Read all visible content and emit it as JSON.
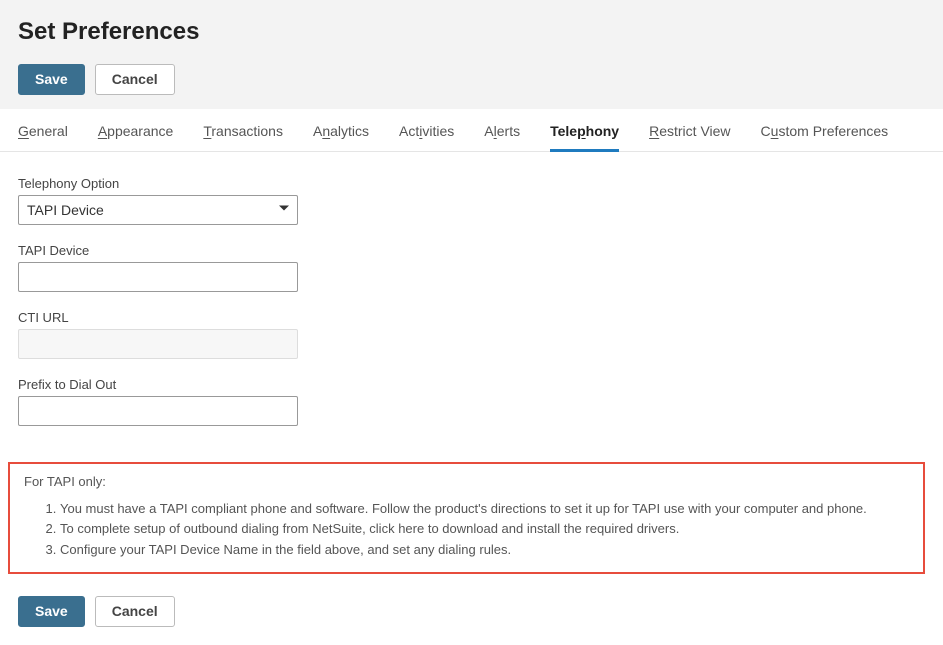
{
  "page": {
    "title": "Set Preferences"
  },
  "buttons": {
    "save": "Save",
    "cancel": "Cancel"
  },
  "tabs": [
    {
      "pre": "",
      "u": "G",
      "post": "eneral",
      "active": false
    },
    {
      "pre": "",
      "u": "A",
      "post": "ppearance",
      "active": false
    },
    {
      "pre": "",
      "u": "T",
      "post": "ransactions",
      "active": false
    },
    {
      "pre": "A",
      "u": "n",
      "post": "alytics",
      "active": false
    },
    {
      "pre": "Act",
      "u": "i",
      "post": "vities",
      "active": false
    },
    {
      "pre": "A",
      "u": "l",
      "post": "erts",
      "active": false
    },
    {
      "pre": "Tele",
      "u": "p",
      "post": "hony",
      "active": true
    },
    {
      "pre": "",
      "u": "R",
      "post": "estrict View",
      "active": false
    },
    {
      "pre": "C",
      "u": "u",
      "post": "stom Preferences",
      "active": false
    }
  ],
  "form": {
    "telephony_option": {
      "label": "Telephony Option",
      "value": "TAPI Device"
    },
    "tapi_device": {
      "label": "TAPI Device",
      "value": ""
    },
    "cti_url": {
      "label": "CTI URL",
      "value": ""
    },
    "prefix": {
      "label": "Prefix to Dial Out",
      "value": ""
    }
  },
  "info": {
    "heading": "For TAPI only:",
    "items": [
      {
        "pre": "You must have a TAPI compliant phone and software. Follow the product's directions to set it up for TAPI use with your computer and phone.",
        "link": "",
        "post": ""
      },
      {
        "pre": "To complete setup of outbound dialing from NetSuite, click ",
        "link": "here",
        "post": " to download and install the required drivers."
      },
      {
        "pre": "Configure your TAPI Device Name in the field above, and set any dialing rules.",
        "link": "",
        "post": ""
      }
    ]
  }
}
